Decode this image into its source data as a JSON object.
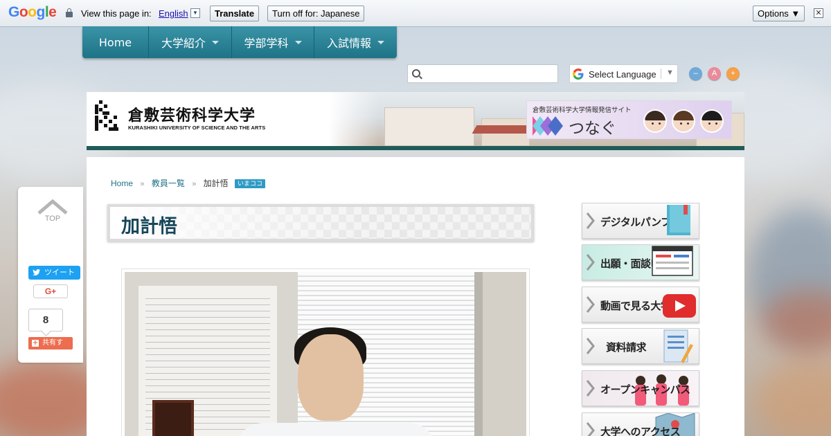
{
  "translate_bar": {
    "logo": "Google",
    "view_text": "View this page in:",
    "language": "English",
    "translate_label": "Translate",
    "turn_off_label": "Turn off for: Japanese",
    "options_label": "Options ▼",
    "close_label": "✕"
  },
  "nav": {
    "items": [
      {
        "label": "Home"
      },
      {
        "label": "大学紹介"
      },
      {
        "label": "学部学科"
      },
      {
        "label": "入試情報"
      }
    ]
  },
  "search": {
    "value": "",
    "placeholder": ""
  },
  "language_select": {
    "label": "Select Language",
    "arrow": "▼"
  },
  "font_size": {
    "minus": "–",
    "reset": "A",
    "plus": "+"
  },
  "header": {
    "title": "倉敷芸術科学大学",
    "subtitle": "KURASHIKI UNIVERSITY OF SCIENCE AND THE ARTS",
    "tsunagu_small": "倉敷芸術科学大学情報発信サイト",
    "tsunagu_big": "つなぐ"
  },
  "breadcrumb": {
    "items": [
      "Home",
      "教員一覧",
      "加計悟"
    ],
    "separator": "»",
    "badge": "いまココ"
  },
  "page_title": "加計悟",
  "sidebar_banners": [
    {
      "label": "デジタルパンフ"
    },
    {
      "label": "出願・面談申込"
    },
    {
      "label": "動画で見る大学"
    },
    {
      "label": "資料請求"
    },
    {
      "label": "オープンキャンパス"
    },
    {
      "label": "大学へのアクセス"
    }
  ],
  "share": {
    "top_label": "TOP",
    "tweet_label": "ツイート",
    "gplus_label": "G+",
    "count": "8",
    "share_label": "共有す"
  },
  "colors": {
    "nav": "#1e7387",
    "header_strip": "#1f5c5a",
    "title_text": "#16465a",
    "tweet": "#1da1f2",
    "share": "#ec6d4f"
  }
}
